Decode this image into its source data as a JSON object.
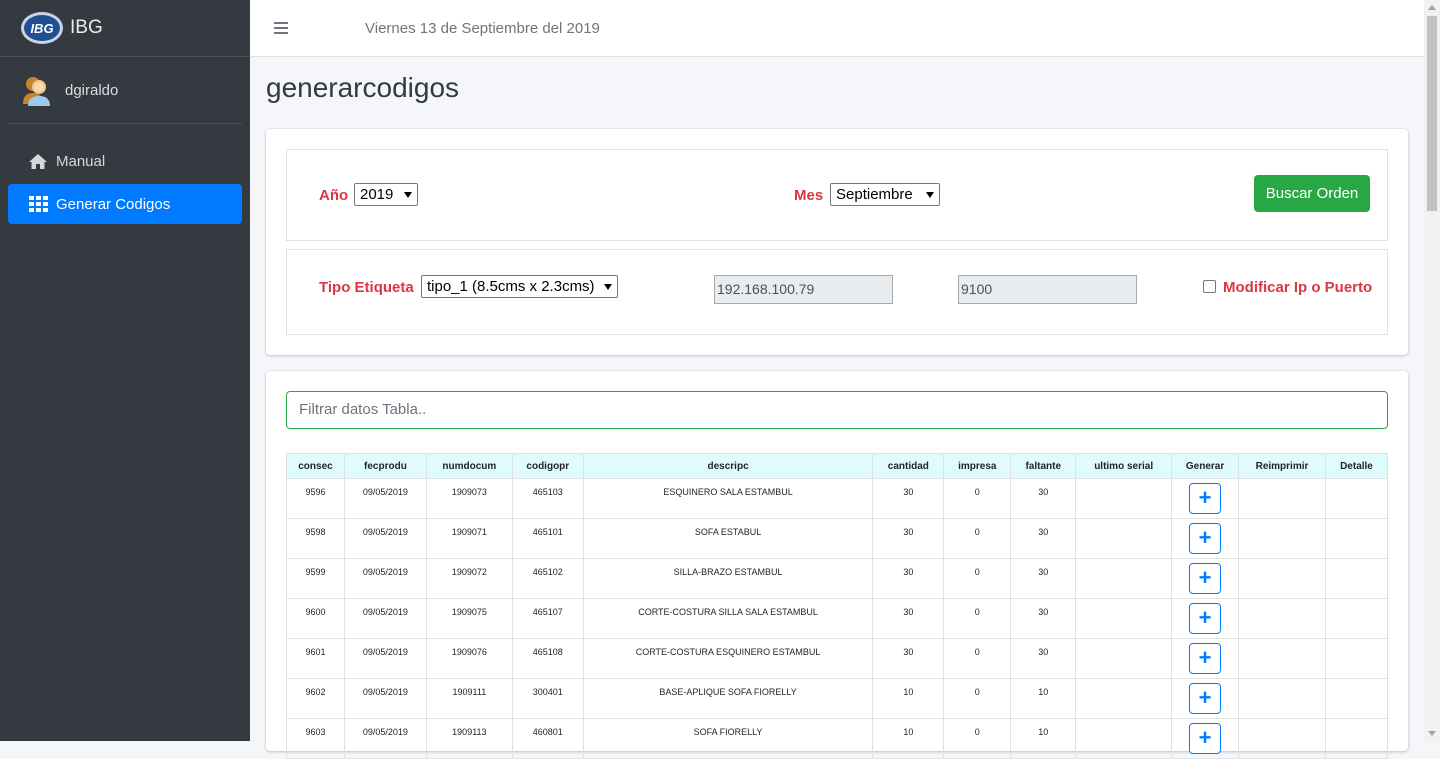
{
  "brand": {
    "logo_text": "IBG",
    "name": "IBG"
  },
  "user": {
    "name": "dgiraldo"
  },
  "nav": [
    {
      "label": "Manual",
      "icon": "home-icon",
      "active": false
    },
    {
      "label": "Generar Codigos",
      "icon": "grid-icon",
      "active": true
    }
  ],
  "topbar": {
    "date": "Viernes 13 de Septiembre del 2019"
  },
  "page": {
    "title": "generarcodigos"
  },
  "form": {
    "year_label": "Año",
    "year_value": "2019",
    "month_label": "Mes",
    "month_value": "Septiembre",
    "search_button": "Buscar Orden",
    "tipo_label": "Tipo Etiqueta",
    "tipo_value": "tipo_1 (8.5cms x 2.3cms)",
    "ip_value": "192.168.100.79",
    "port_value": "9100",
    "modify_label": "Modificar Ip o Puerto"
  },
  "filter": {
    "placeholder": "Filtrar datos Tabla.."
  },
  "table": {
    "headers": [
      "consec",
      "fecprodu",
      "numdocum",
      "codigopr",
      "descripc",
      "cantidad",
      "impresa",
      "faltante",
      "ultimo serial",
      "Generar",
      "Reimprimir",
      "Detalle"
    ],
    "rows": [
      [
        "9596",
        "09/05/2019",
        "1909073",
        "465103",
        "ESQUINERO SALA ESTAMBUL",
        "30",
        "0",
        "30",
        "",
        "+",
        "",
        ""
      ],
      [
        "9598",
        "09/05/2019",
        "1909071",
        "465101",
        "SOFA ESTABUL",
        "30",
        "0",
        "30",
        "",
        "+",
        "",
        ""
      ],
      [
        "9599",
        "09/05/2019",
        "1909072",
        "465102",
        "SILLA-BRAZO ESTAMBUL",
        "30",
        "0",
        "30",
        "",
        "+",
        "",
        ""
      ],
      [
        "9600",
        "09/05/2019",
        "1909075",
        "465107",
        "CORTE-COSTURA SILLA SALA ESTAMBUL",
        "30",
        "0",
        "30",
        "",
        "+",
        "",
        ""
      ],
      [
        "9601",
        "09/05/2019",
        "1909076",
        "465108",
        "CORTE-COSTURA ESQUINERO ESTAMBUL",
        "30",
        "0",
        "30",
        "",
        "+",
        "",
        ""
      ],
      [
        "9602",
        "09/05/2019",
        "1909111",
        "300401",
        "BASE-APLIQUE SOFA FIORELLY",
        "10",
        "0",
        "10",
        "",
        "+",
        "",
        ""
      ],
      [
        "9603",
        "09/05/2019",
        "1909113",
        "460801",
        "SOFA FIORELLY",
        "10",
        "0",
        "10",
        "",
        "+",
        "",
        ""
      ]
    ]
  },
  "colors": {
    "sidebar": "#343a40",
    "accent": "#007bff",
    "success": "#28a745",
    "label_red": "#dc3545",
    "header_bg": "#e0fbfc"
  }
}
